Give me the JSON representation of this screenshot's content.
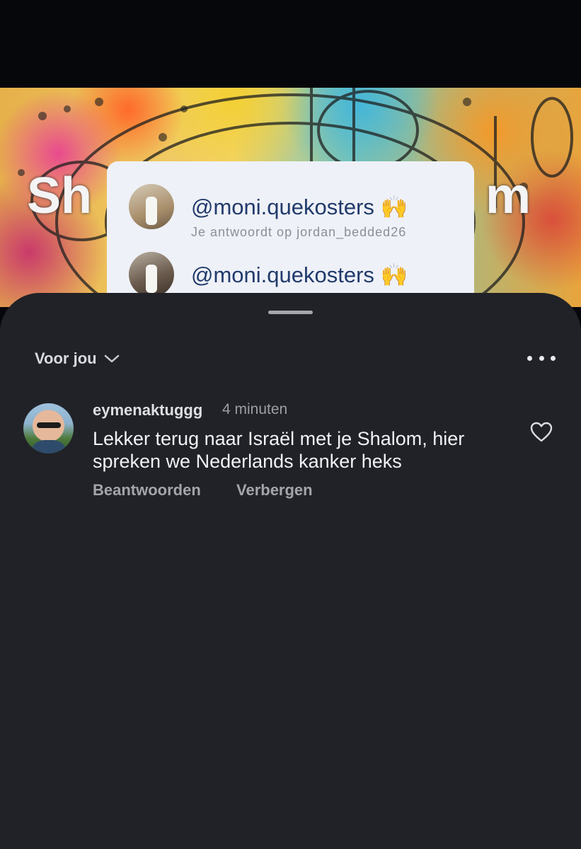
{
  "background_post": {
    "popup": {
      "rows": [
        {
          "handle": "@moni.quekosters 🙌"
        },
        {
          "handle": "@moni.quekosters 🙌"
        }
      ],
      "subtext": "Je antwoordt op jordan_bedded26"
    },
    "overlay_text_left": "Sh",
    "overlay_text_right": "m"
  },
  "sheet": {
    "sort_label": "Voor jou",
    "comments": [
      {
        "username": "eymenaktuggg",
        "time": "4 minuten",
        "text": "Lekker terug naar Israël met je Shalom, hier spreken we Nederlands kanker heks",
        "reply_label": "Beantwoorden",
        "hide_label": "Verbergen"
      }
    ]
  },
  "colors": {
    "sheet_bg": "#212227",
    "accent_handle": "#213a6b",
    "muted_text": "#a3a5ac"
  },
  "icons": {
    "sort": "chevron-down-icon",
    "more": "more-horizontal-icon",
    "like": "heart-icon"
  }
}
